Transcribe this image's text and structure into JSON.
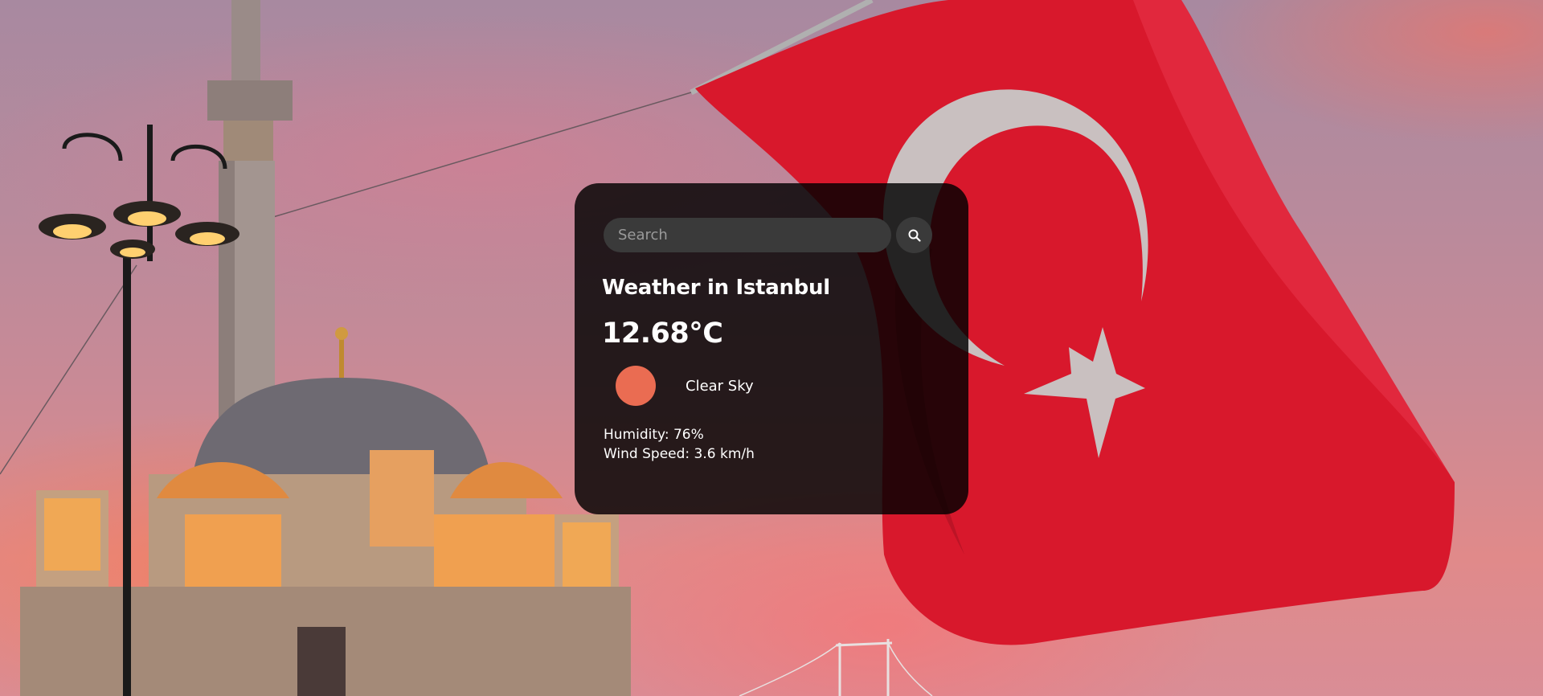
{
  "search": {
    "placeholder": "Search",
    "icon": "search-icon"
  },
  "weather": {
    "title": "Weather in Istanbul",
    "temperature": "12.68°C",
    "condition_icon": "clear-sky-icon",
    "condition_icon_color": "#ea6c52",
    "condition": "Clear Sky",
    "humidity": "Humidity: 76%",
    "wind": "Wind Speed: 3.6 km/h"
  },
  "background": {
    "description_icon": "istanbul-mosque-and-turkish-flag-photo"
  }
}
